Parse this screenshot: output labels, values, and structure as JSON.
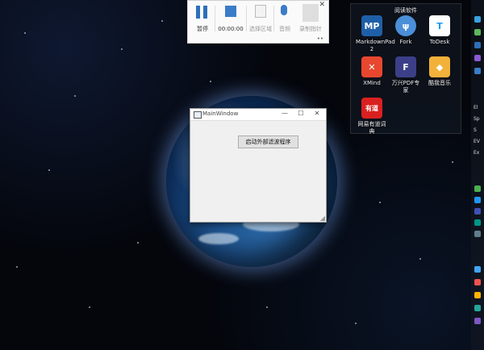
{
  "recorder": {
    "buttons": [
      {
        "label": "暂停",
        "icon": "pause-icon"
      },
      {
        "label": "00:00:00",
        "icon": "stop-icon"
      },
      {
        "label": "选择区域",
        "icon": "region-select-icon"
      },
      {
        "label": "音频",
        "icon": "microphone-icon"
      },
      {
        "label": "录制指针",
        "icon": "pointer-icon"
      }
    ],
    "close_glyph": "✕",
    "more_glyph": "••"
  },
  "desktop_panel": {
    "title": "阅读软件",
    "apps": [
      {
        "name": "MarkdownPad 2",
        "icon": "markdownpad-icon",
        "badge": "MP",
        "color": "#1f5fa8"
      },
      {
        "name": "Fork",
        "icon": "fork-icon",
        "badge": "ψ",
        "color": "#4a8fd8"
      },
      {
        "name": "ToDesk",
        "icon": "todesk-icon",
        "badge": "T",
        "color": "#1a9bf0"
      },
      {
        "name": "XMind",
        "icon": "xmind-icon",
        "badge": "✕",
        "color": "#e8472f"
      },
      {
        "name": "万兴PDF专家",
        "icon": "pdf-expert-icon",
        "badge": "F",
        "color": "#3b3f88"
      },
      {
        "name": "酷我音乐",
        "icon": "kuwo-music-icon",
        "badge": "◆",
        "color": "#f2b13a"
      },
      {
        "name": "网易有道词典",
        "icon": "youdao-dict-icon",
        "badge": "有道",
        "color": "#d92020"
      }
    ]
  },
  "right_strip": {
    "labels": [
      "El",
      "Sp",
      "S",
      "EV",
      "Ex"
    ]
  },
  "main_window": {
    "title": "MainWindow",
    "minimize_glyph": "—",
    "maximize_glyph": "☐",
    "close_glyph": "✕",
    "button_label": "启动外部滤波程序"
  }
}
